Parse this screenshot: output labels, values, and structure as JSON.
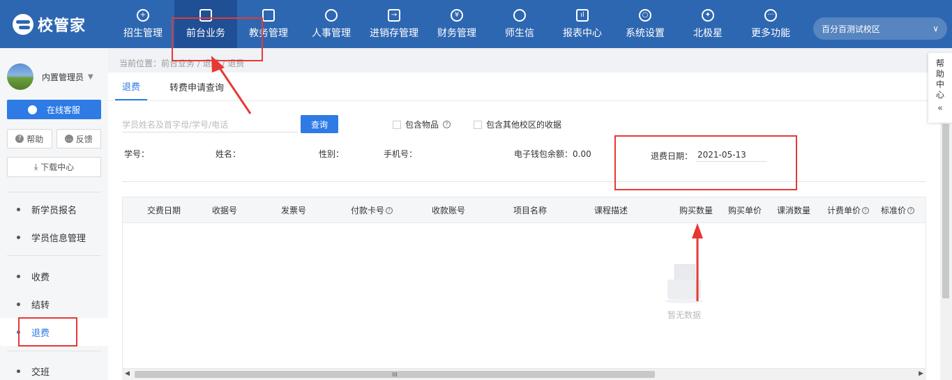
{
  "header": {
    "logo_text": "校管家",
    "nav": [
      {
        "label": "招生管理",
        "icon": "user-plus-icon"
      },
      {
        "label": "前台业务",
        "icon": "monitor-icon",
        "active": true
      },
      {
        "label": "教务管理",
        "icon": "book-icon"
      },
      {
        "label": "人事管理",
        "icon": "person-icon"
      },
      {
        "label": "进销存管理",
        "icon": "inventory-icon"
      },
      {
        "label": "财务管理",
        "icon": "yen-icon"
      },
      {
        "label": "师生信",
        "icon": "chat-icon"
      },
      {
        "label": "报表中心",
        "icon": "chart-icon"
      },
      {
        "label": "系统设置",
        "icon": "gear-icon"
      },
      {
        "label": "北极星",
        "icon": "star-icon"
      },
      {
        "label": "更多功能",
        "icon": "more-icon"
      }
    ],
    "campus": "百分百测试校区"
  },
  "sidebar": {
    "user_name": "内置管理员",
    "service_button": "在线客服",
    "help_button": "帮助",
    "feedback_button": "反馈",
    "download_button": "下载中心",
    "menu": [
      {
        "label": "新学员报名"
      },
      {
        "label": "学员信息管理"
      },
      {
        "label": "收费"
      },
      {
        "label": "结转"
      },
      {
        "label": "退费",
        "active": true
      },
      {
        "label": "交班"
      }
    ]
  },
  "breadcrumb": "当前位置：前台业务 / 退费 / 退费",
  "tabs": [
    "退费",
    "转费申请查询"
  ],
  "search": {
    "placeholder": "学员姓名及首字母/学号/电话",
    "value": "",
    "button": "查询"
  },
  "options": {
    "include_items": "包含物品",
    "include_other_campus": "包含其他校区的收据"
  },
  "student_info": {
    "student_no_label": "学号：",
    "name_label": "姓名：",
    "gender_label": "性别：",
    "phone_label": "手机号：",
    "wallet_label": "电子钱包余额：",
    "wallet_value": "0.00",
    "refund_date_label": "退费日期：",
    "refund_date_value": "2021-05-13"
  },
  "table": {
    "columns": [
      "交费日期",
      "收据号",
      "发票号",
      "付款卡号",
      "收款账号",
      "项目名称",
      "课程描述",
      "购买数量",
      "购买单价",
      "课消数量",
      "计费单价",
      "标准价"
    ],
    "rows": [],
    "empty_text": "暂无数据"
  },
  "help_center": "帮助中心",
  "colors": {
    "header_bg": "#2e67b1",
    "accent": "#2e7be6",
    "annotation": "#e53935"
  }
}
